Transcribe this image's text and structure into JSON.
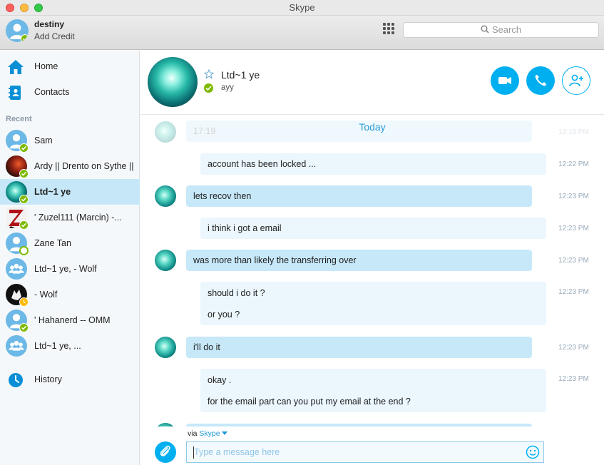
{
  "window": {
    "title": "Skype"
  },
  "profile": {
    "name": "destiny",
    "credit_link": "Add Credit",
    "status": "online"
  },
  "toolbar": {
    "dialpad_icon": "dialpad-icon",
    "search_placeholder": "Search"
  },
  "nav": [
    {
      "label": "Home",
      "icon": "home-icon"
    },
    {
      "label": "Contacts",
      "icon": "contacts-book-icon"
    }
  ],
  "recent_label": "Recent",
  "contacts": [
    {
      "name": "Sam",
      "status": "online",
      "avatar": "default-person"
    },
    {
      "name": "Ardy || Drento on Sythe ||",
      "status": "online",
      "avatar": "photo-red"
    },
    {
      "name": "Ltd~1 ye",
      "status": "online",
      "avatar": "photo-teal",
      "selected": true
    },
    {
      "name": "' Zuzel111 (Marcin) -...",
      "status": "online",
      "avatar": "photo-z"
    },
    {
      "name": "Zane Tan",
      "status": "offline",
      "avatar": "default-person"
    },
    {
      "name": "Ltd~1 ye, - Wolf",
      "status": "group",
      "avatar": "group"
    },
    {
      "name": "- Wolf",
      "status": "away",
      "avatar": "photo-wolf"
    },
    {
      "name": "' Hahanerd -- OMM",
      "status": "online",
      "avatar": "default-person"
    },
    {
      "name": "Ltd~1 ye, ...",
      "status": "group",
      "avatar": "group"
    }
  ],
  "history": {
    "label": "History",
    "icon": "clock-icon"
  },
  "conversation": {
    "name": "Ltd~1 ye",
    "mood": "ayy",
    "status": "online",
    "actions": [
      "video-call-button",
      "audio-call-button",
      "add-participant-button"
    ]
  },
  "messages": {
    "faded_time": "17:19",
    "faded_right_time": "12:19 PM",
    "today_label": "Today",
    "items": [
      {
        "dir": "out",
        "lines": [
          "account has been locked ..."
        ],
        "time": "12:22 PM"
      },
      {
        "dir": "in",
        "lines": [
          "lets recov then"
        ],
        "time": "12:23 PM"
      },
      {
        "dir": "out",
        "lines": [
          "i think i got a email"
        ],
        "time": "12:23 PM"
      },
      {
        "dir": "in",
        "lines": [
          "was more than likely the transferring over"
        ],
        "time": "12:23 PM"
      },
      {
        "dir": "out",
        "lines": [
          "should i do it ?",
          "or you ?"
        ],
        "time": "12:23 PM"
      },
      {
        "dir": "in",
        "lines": [
          "i'll do it"
        ],
        "time": "12:23 PM"
      },
      {
        "dir": "out",
        "lines": [
          "okay .",
          "for the email part can you put my email at the end ?"
        ],
        "time": "12:23 PM"
      }
    ]
  },
  "composer": {
    "via_prefix": "via",
    "via_service": "Skype",
    "placeholder": "Type a message here"
  },
  "colors": {
    "accent": "#00aff0",
    "incoming_bubble": "#c7e8f9",
    "outgoing_bubble": "#ebf6fd",
    "online": "#7fba00",
    "away": "#ffb900",
    "selected_row": "#c6e7f8"
  }
}
